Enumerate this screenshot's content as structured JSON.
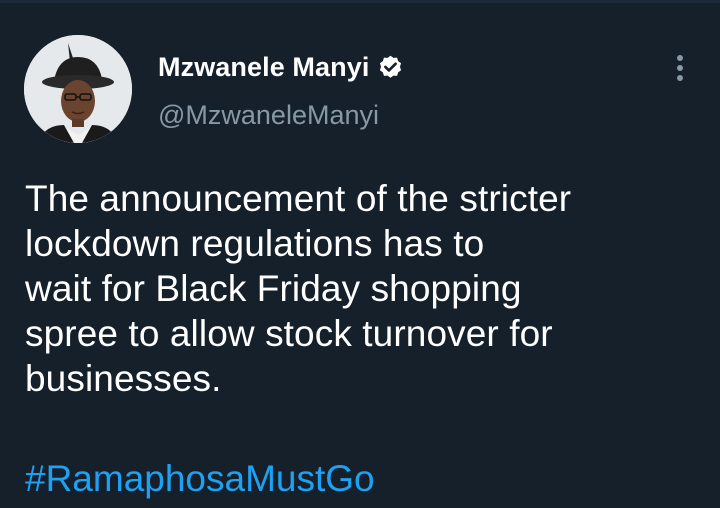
{
  "author": {
    "display_name": "Mzwanele Manyi",
    "handle": "@MzwaneleManyi",
    "verified_icon": "verified-badge-icon"
  },
  "tweet": {
    "lines": [
      "The announcement of the stricter",
      "lockdown regulations has to",
      "wait for Black Friday shopping",
      "spree to allow stock turnover for",
      "businesses."
    ],
    "hashtag": "#RamaphosaMustGo"
  },
  "menu": {
    "icon": "more-options-icon"
  },
  "colors": {
    "background": "#15202b",
    "text": "#ffffff",
    "secondary_text": "#8899a6",
    "link": "#1da1f2"
  }
}
